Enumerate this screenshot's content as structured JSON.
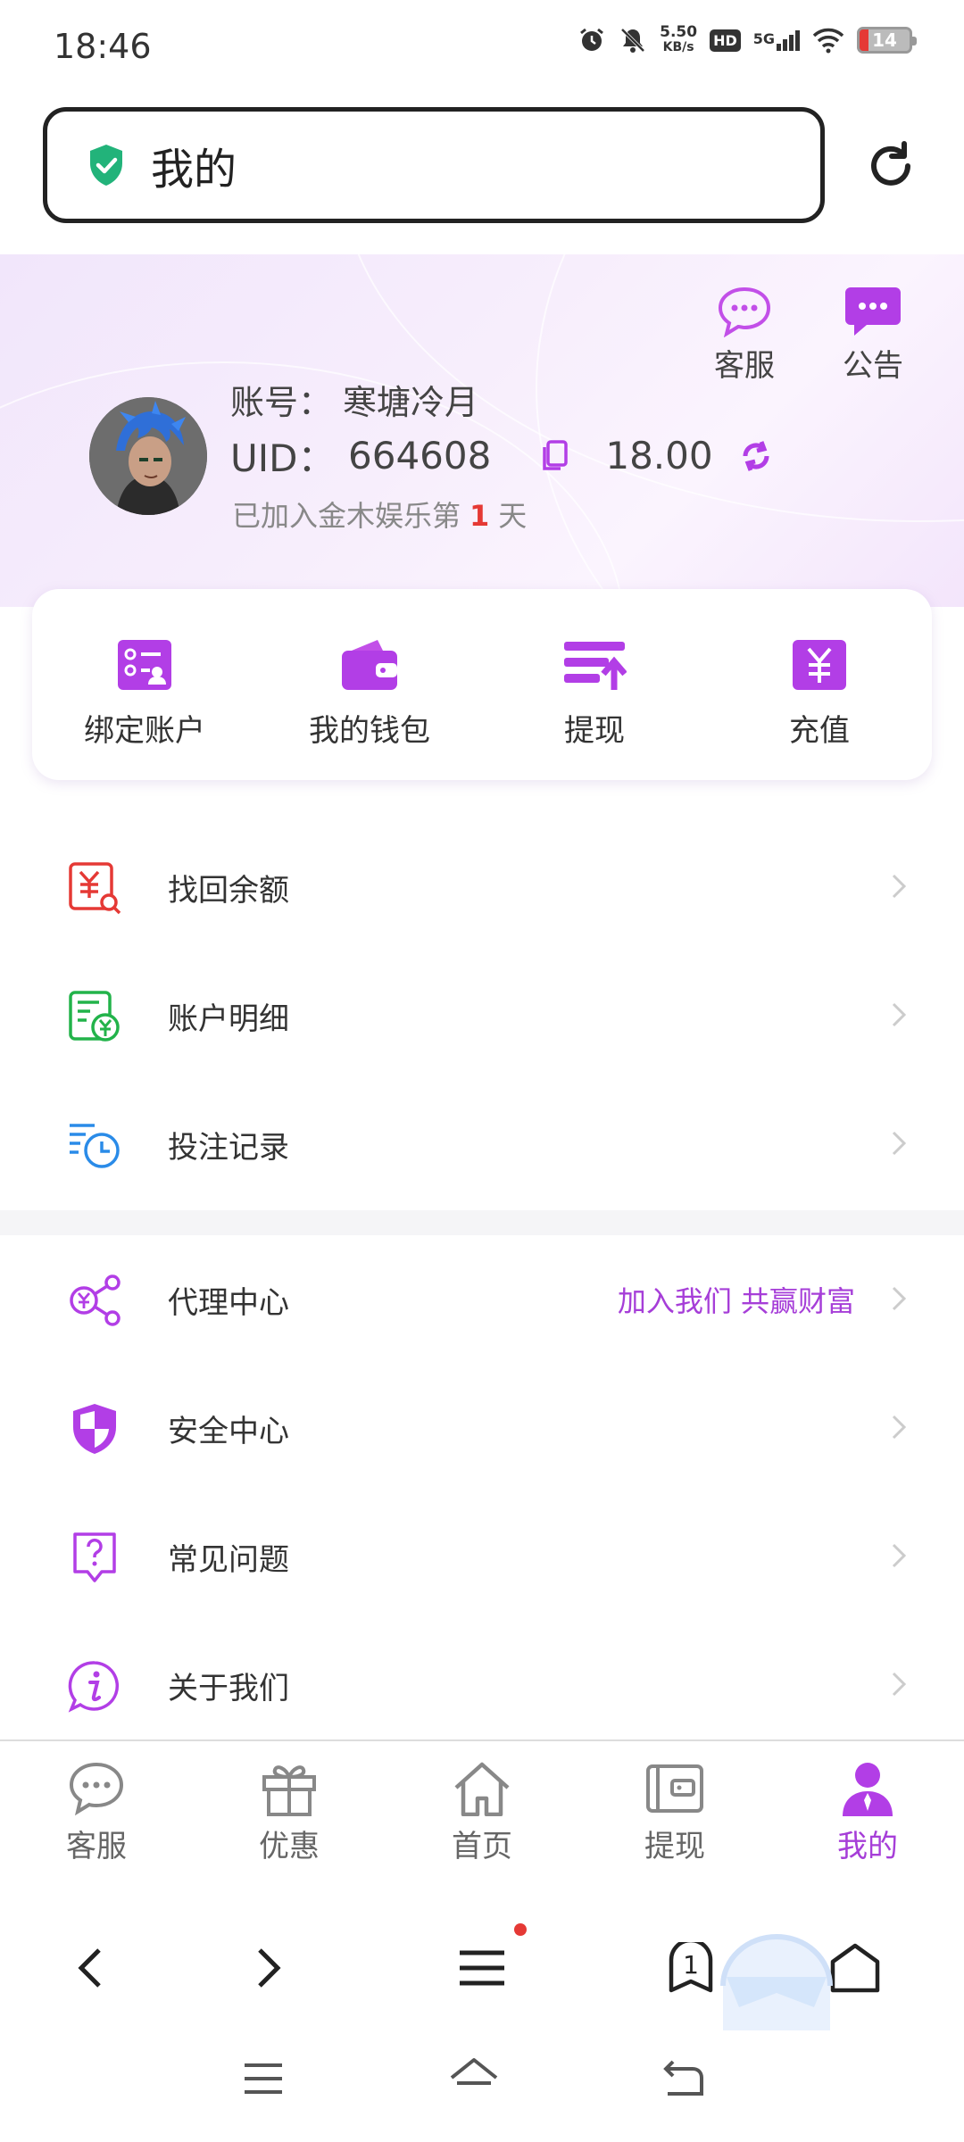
{
  "status_bar": {
    "time": "18:46",
    "net_speed_value": "5.50",
    "net_speed_unit": "KB/s",
    "hd": "HD",
    "signal": "5G",
    "battery": "14"
  },
  "browser": {
    "address_title": "我的",
    "tab_count": "1"
  },
  "header": {
    "service_label": "客服",
    "announce_label": "公告"
  },
  "user": {
    "account_label": "账号：",
    "account_name": "寒塘冷月",
    "uid_label": "UID：",
    "uid": "664608",
    "balance": "18.00",
    "join_prefix": "已加入金木娱乐第",
    "join_days": "1",
    "join_suffix": "天"
  },
  "quick_actions": [
    {
      "label": "绑定账户",
      "icon": "bind-account-icon"
    },
    {
      "label": "我的钱包",
      "icon": "wallet-icon"
    },
    {
      "label": "提现",
      "icon": "withdraw-icon"
    },
    {
      "label": "充值",
      "icon": "recharge-icon"
    }
  ],
  "menu_group_1": [
    {
      "label": "找回余额",
      "icon": "recover-balance-icon"
    },
    {
      "label": "账户明细",
      "icon": "account-details-icon"
    },
    {
      "label": "投注记录",
      "icon": "bet-record-icon"
    }
  ],
  "menu_group_2": [
    {
      "label": "代理中心",
      "icon": "agent-center-icon",
      "extra": "加入我们 共赢财富"
    },
    {
      "label": "安全中心",
      "icon": "security-center-icon"
    },
    {
      "label": "常见问题",
      "icon": "faq-icon"
    },
    {
      "label": "关于我们",
      "icon": "about-us-icon"
    }
  ],
  "tabbar": [
    {
      "label": "客服",
      "icon": "chat-icon",
      "active": false
    },
    {
      "label": "优惠",
      "icon": "gift-icon",
      "active": false
    },
    {
      "label": "首页",
      "icon": "home-icon",
      "active": false
    },
    {
      "label": "提现",
      "icon": "wallet-card-icon",
      "active": false
    },
    {
      "label": "我的",
      "icon": "user-icon",
      "active": true
    }
  ],
  "colors": {
    "accent": "#a63ed8",
    "accent_light": "#c24fe8",
    "red": "#e53935",
    "green": "#22b34a",
    "blue": "#2a8be8"
  }
}
